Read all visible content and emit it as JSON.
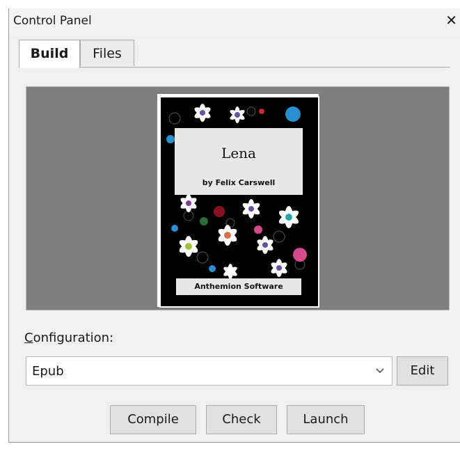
{
  "window": {
    "title": "Control Panel",
    "close_glyph": "✕"
  },
  "tabs": [
    {
      "label": "Build",
      "active": true
    },
    {
      "label": "Files",
      "active": false
    }
  ],
  "cover": {
    "title": "Lena",
    "author": "by Felix Carswell",
    "publisher": "Anthemion Software"
  },
  "configuration": {
    "label_accel": "C",
    "label_rest": "onfiguration:",
    "selected": "Epub",
    "edit_label": "Edit"
  },
  "actions": {
    "compile": "Compile",
    "check": "Check",
    "launch": "Launch"
  },
  "colors": {
    "preview_bg": "#7f7f7f",
    "panel_bg": "#f0f0f0",
    "button_bg": "#e1e1e1"
  }
}
